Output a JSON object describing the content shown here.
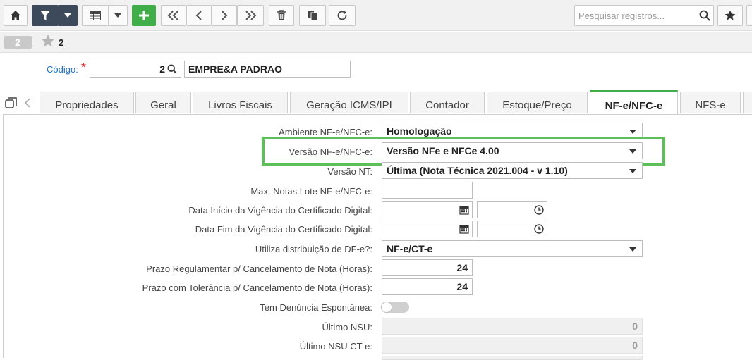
{
  "toolbar": {
    "search_placeholder": "Pesquisar registros...",
    "icons": [
      "home-icon",
      "filter-icon",
      "chevron-down-icon",
      "table-icon",
      "chevron-down-icon",
      "plus-icon",
      "first-icon",
      "prev-icon",
      "next-icon",
      "last-icon",
      "trash-icon",
      "copy-icon",
      "refresh-icon",
      "search-icon",
      "star-icon"
    ]
  },
  "record": {
    "number": "2",
    "favorite_label": "2"
  },
  "header": {
    "codigo_label": "Código:",
    "required_mark": "*",
    "codigo_value": "2",
    "empresa_value": "EMPRE&A PADRAO"
  },
  "tabs": [
    {
      "label": "Propriedades"
    },
    {
      "label": "Geral"
    },
    {
      "label": "Livros Fiscais"
    },
    {
      "label": "Geração ICMS/IPI"
    },
    {
      "label": "Contador"
    },
    {
      "label": "Estoque/Preço"
    },
    {
      "label": "NF-e/NFC-e",
      "active": true
    },
    {
      "label": "NFS-e"
    }
  ],
  "form": {
    "ambiente": {
      "label": "Ambiente NF-e/NFC-e:",
      "value": "Homologação"
    },
    "versao": {
      "label": "Versão NF-e/NFC-e:",
      "value": "Versão NFe e NFCe 4.00"
    },
    "versao_nt": {
      "label": "Versão NT:",
      "value": "Última (Nota Técnica 2021.004 - v 1.10)"
    },
    "max_notas": {
      "label": "Max. Notas Lote NF-e/NFC-e:",
      "value": ""
    },
    "data_inicio": {
      "label": "Data Início da Vigência do Certificado Digital:",
      "date": "",
      "time": ""
    },
    "data_fim": {
      "label": "Data Fim da Vigência do Certificado Digital:",
      "date": "",
      "time": ""
    },
    "distribuicao": {
      "label": "Utiliza distribuição de DF-e?:",
      "value": "NF-e/CT-e"
    },
    "prazo_reg": {
      "label": "Prazo Regulamentar p/ Cancelamento de Nota (Horas):",
      "value": "24"
    },
    "prazo_tol": {
      "label": "Prazo com Tolerância p/ Cancelamento de Nota (Horas):",
      "value": "24"
    },
    "denuncia": {
      "label": "Tem Denúncia Espontânea:",
      "checked": false
    },
    "ultimo_nsu": {
      "label": "Último NSU:",
      "value": "0"
    },
    "ultimo_nsu_cte": {
      "label": "Último NSU CT-e:",
      "value": "0"
    }
  },
  "colors": {
    "accent_green": "#3fae49",
    "toolbar_dark": "#3d4a5b",
    "highlight": "#5cbf5a",
    "link_blue": "#1a73c8"
  }
}
